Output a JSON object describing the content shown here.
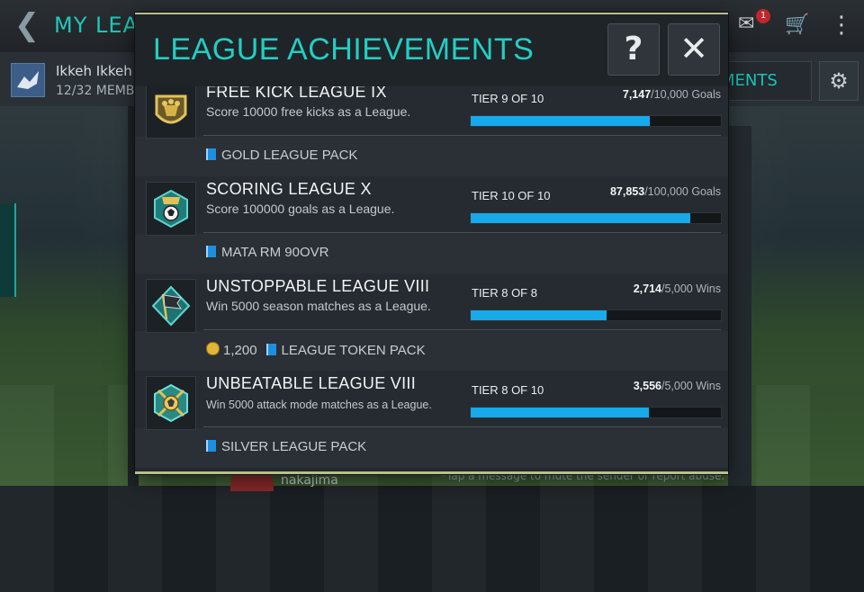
{
  "background": {
    "title": "MY LEAG",
    "league_name": "Ikkeh Ikkeh -",
    "members": "12/32 MEMB",
    "tab_right_label": "MENTS",
    "mail_badge": "1",
    "footer_text": "*Tap a message to mute the sender or report abuse.",
    "user_name": "nakajima"
  },
  "modal": {
    "title": "LEAGUE ACHIEVEMENTS",
    "help_label": "?",
    "close_label": "✕"
  },
  "achievements": [
    {
      "name": "FREE KICK LEAGUE IX",
      "description": "Score 10000 free kicks as a League.",
      "tier": "TIER 9 OF 10",
      "current": "7,147",
      "target": "/10,000 Goals",
      "progress": 0.7147,
      "reward_coins": "",
      "reward_pack": "GOLD LEAGUE PACK",
      "icon": "free-kick-trophy-icon"
    },
    {
      "name": "SCORING LEAGUE X",
      "description": "Score 100000 goals as a League.",
      "tier": "TIER 10 OF 10",
      "current": "87,853",
      "target": "/100,000 Goals",
      "progress": 0.8785,
      "reward_coins": "",
      "reward_pack": "MATA RM 90OVR",
      "icon": "scoring-ball-icon"
    },
    {
      "name": "UNSTOPPABLE LEAGUE VIII",
      "description": "Win 5000 season matches as a League.",
      "tier": "TIER 8 OF 8",
      "current": "2,714",
      "target": "/5,000 Wins",
      "progress": 0.5428,
      "reward_coins": "1,200",
      "reward_pack": "LEAGUE TOKEN PACK",
      "icon": "flag-icon"
    },
    {
      "name": "UNBEATABLE LEAGUE VIII",
      "description": "Win 5000 attack mode matches as a League.",
      "tier": "TIER 8 OF 10",
      "current": "3,556",
      "target": "/5,000 Wins",
      "progress": 0.7112,
      "reward_coins": "",
      "reward_pack": "SILVER LEAGUE PACK",
      "icon": "crossed-swords-icon"
    }
  ],
  "colors": {
    "accent_teal": "#23cec2",
    "progress_blue": "#17a9ea",
    "modal_border": "#b9bf8b"
  }
}
